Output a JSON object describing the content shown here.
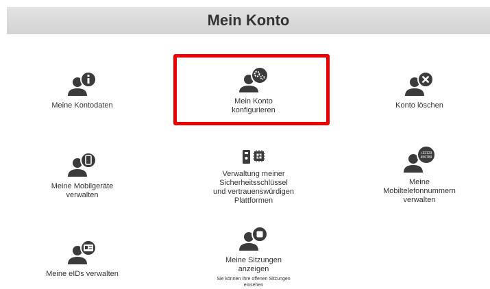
{
  "header": {
    "title": "Mein Konto"
  },
  "tiles": {
    "kontodaten": {
      "label": "Meine Kontodaten"
    },
    "konfigurieren": {
      "label": "Mein Konto\nkonfigurieren"
    },
    "loeschen": {
      "label": "Konto löschen"
    },
    "mobilgeraete": {
      "label": "Meine Mobilgeräte\nverwalten"
    },
    "sicherheitsschluessel": {
      "label": "Verwaltung meiner\nSicherheitsschlüssel\nund vertrauenswürdigen\nPlattformen"
    },
    "mobilnummern": {
      "label": "Meine\nMobiltelefonnummern\nverwalten",
      "icon_text_1": "+32123",
      "icon_text_2": "456789"
    },
    "eids": {
      "label": "Meine eIDs verwalten"
    },
    "sitzungen": {
      "label": "Meine Sitzungen\nanzeigen",
      "sub": "Sie können Ihre offenen Sitzungen\neinsehen"
    }
  },
  "colors": {
    "icon": "#3b3b3b",
    "highlight": "#ee0000",
    "header_bg": "#d9d9d9"
  },
  "icons": {
    "kontodaten": "user-info-icon",
    "konfigurieren": "user-settings-icon",
    "loeschen": "user-delete-icon",
    "mobilgeraete": "user-mobile-icon",
    "sicherheitsschluessel": "security-key-chip-icon",
    "mobilnummern": "user-phone-number-icon",
    "eids": "user-id-card-icon",
    "sitzungen": "user-session-icon"
  }
}
